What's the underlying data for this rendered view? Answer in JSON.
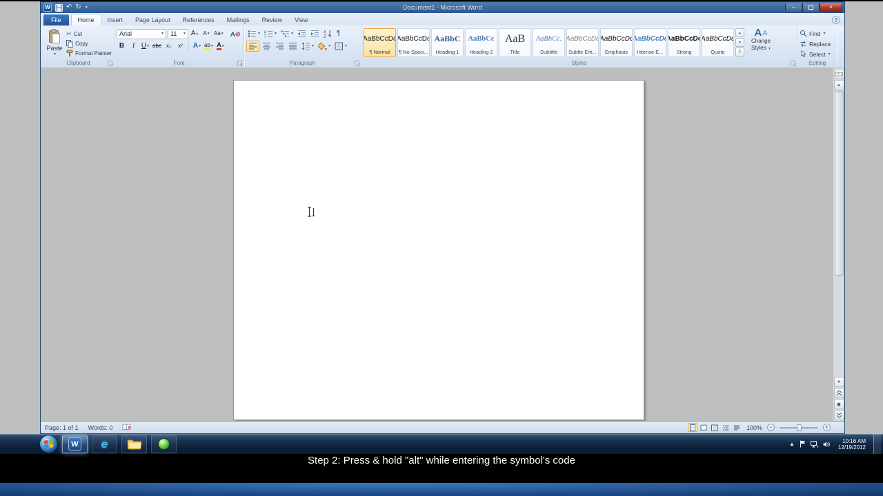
{
  "titlebar": {
    "title": "Document1 - Microsoft Word"
  },
  "tabs": {
    "file": "File",
    "home": "Home",
    "insert": "Insert",
    "page_layout": "Page Layout",
    "references": "References",
    "mailings": "Mailings",
    "review": "Review",
    "view": "View"
  },
  "clipboard": {
    "label": "Clipboard",
    "paste": "Paste",
    "cut": "Cut",
    "copy": "Copy",
    "format_painter": "Format Painter"
  },
  "font": {
    "label": "Font",
    "family": "Arial",
    "size": "11",
    "bold": "B",
    "italic": "I",
    "underline": "U",
    "strike": "abc",
    "subscript": "x₂",
    "superscript": "x²",
    "grow": "A",
    "shrink": "A",
    "change_case": "Aa",
    "effects": "A",
    "highlight": "ab",
    "color": "A"
  },
  "paragraph": {
    "label": "Paragraph"
  },
  "styles": {
    "label": "Styles",
    "items": [
      {
        "preview": "AaBbCcDc",
        "name": "¶ Normal"
      },
      {
        "preview": "AaBbCcDc",
        "name": "¶ No Spaci..."
      },
      {
        "preview": "AaBbC",
        "name": "Heading 1"
      },
      {
        "preview": "AaBbCc",
        "name": "Heading 2"
      },
      {
        "preview": "AaB",
        "name": "Title"
      },
      {
        "preview": "AaBbCc.",
        "name": "Subtitle"
      },
      {
        "preview": "AaBbCcDc",
        "name": "Subtle Em..."
      },
      {
        "preview": "AaBbCcDc",
        "name": "Emphasis"
      },
      {
        "preview": "AaBbCcDc",
        "name": "Intense E..."
      },
      {
        "preview": "AaBbCcDc",
        "name": "Strong"
      },
      {
        "preview": "AaBbCcDc",
        "name": "Quote"
      }
    ],
    "change_icon_big": "A",
    "change_icon_small": "A",
    "change_line1": "Change",
    "change_line2": "Styles"
  },
  "editing": {
    "label": "Editing",
    "find": "Find",
    "replace": "Replace",
    "select": "Select"
  },
  "status": {
    "page": "Page: 1 of 1",
    "words": "Words: 0",
    "zoom": "100%"
  },
  "tray": {
    "time": "10:16 AM",
    "date": "12/19/2012"
  },
  "taskbar": {
    "word_letter": "W",
    "ie_letter": "e"
  },
  "caption": {
    "text": "Step 2: Press & hold \"alt\" while entering the symbol's code"
  },
  "icons": {
    "dropdown": "▾",
    "undo": "↶",
    "redo": "↻",
    "scissors": "✂",
    "pilcrow": "¶",
    "up": "▲",
    "down": "▼",
    "more": "▾",
    "minus": "−",
    "plus": "+",
    "win_min": "–",
    "win_close": "×",
    "help": "?",
    "tray_expand": "▲",
    "word_glyph": "W"
  }
}
